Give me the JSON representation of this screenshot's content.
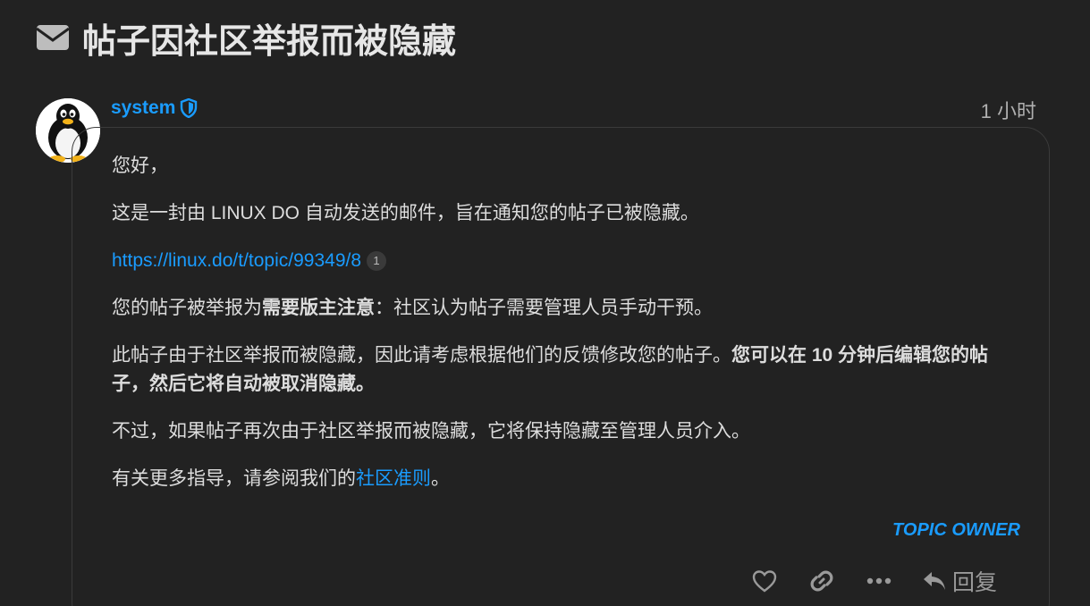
{
  "page": {
    "title": "帖子因社区举报而被隐藏",
    "title_icon": "envelope-icon"
  },
  "post": {
    "username": "system",
    "user_badge_icon": "shield-icon",
    "avatar_icon": "tux-penguin-icon",
    "time": "1 小时",
    "greeting": "您好，",
    "intro": "这是一封由 LINUX DO 自动发送的邮件，旨在通知您的帖子已被隐藏。",
    "link": {
      "text": "https://linux.do/t/topic/99349/8",
      "click_count": "1"
    },
    "reason": {
      "prefix": "您的帖子被举报为",
      "bold": "需要版主注意",
      "suffix": "：社区认为帖子需要管理人员手动干预。"
    },
    "hidden_notice": {
      "normal": "此帖子由于社区举报而被隐藏，因此请考虑根据他们的反馈修改您的帖子。",
      "bold": "您可以在 10 分钟后编辑您的帖子，然后它将自动被取消隐藏。"
    },
    "warning": "不过，如果帖子再次由于社区举报而被隐藏，它将保持隐藏至管理人员介入。",
    "guidance": {
      "prefix": "有关更多指导，请参阅我们的",
      "link_text": "社区准则",
      "suffix": "。"
    },
    "owner_label": "TOPIC OWNER"
  },
  "actions": {
    "like_icon": "heart-icon",
    "link_icon": "link-icon",
    "more_icon": "ellipsis-icon",
    "reply_icon": "reply-arrow-icon",
    "reply_label": "回复"
  },
  "colors": {
    "background": "#222222",
    "accent": "#1a9cff",
    "text": "#dddddd",
    "muted": "#9a9a9a"
  }
}
